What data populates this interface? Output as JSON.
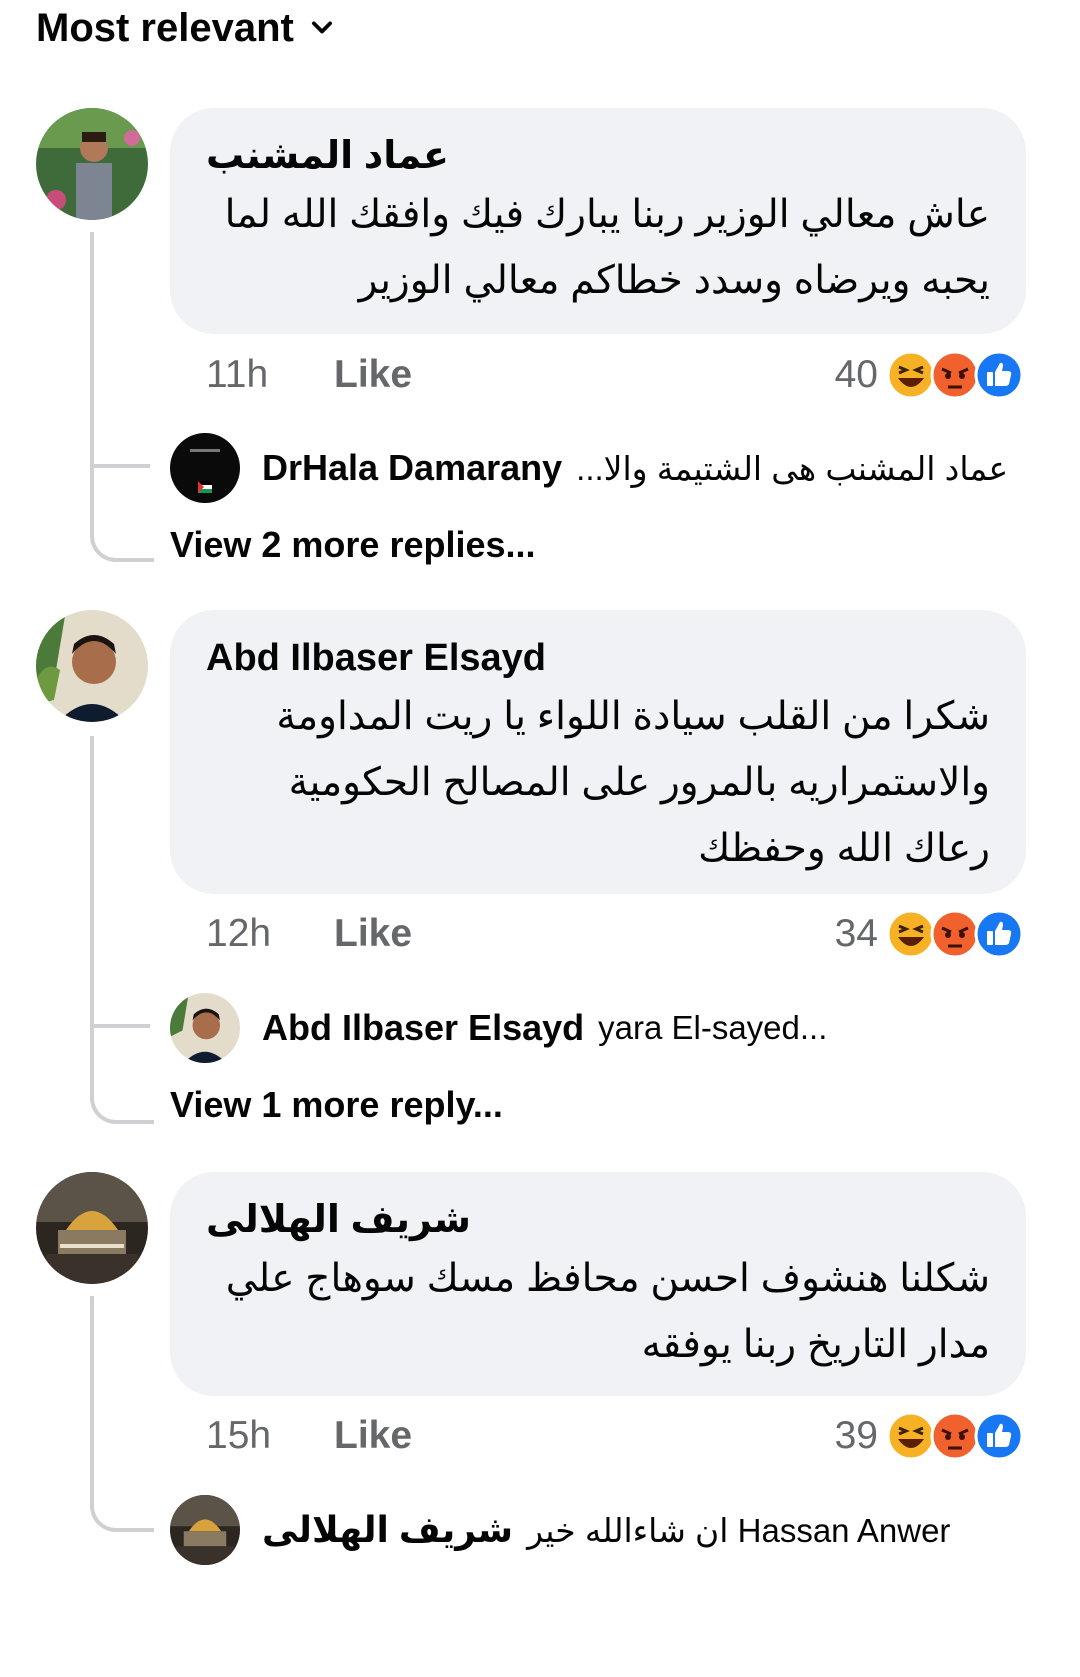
{
  "sort": {
    "label": "Most relevant"
  },
  "comments": [
    {
      "author": "عماد المشنب",
      "text": "عاش معالي الوزير ربنا يبارك فيك وافقك الله لما يحبه ويرضاه وسدد خطاكم معالي الوزير",
      "time": "11h",
      "like_label": "Like",
      "reaction_count": "40",
      "reply": {
        "author": "DrHala Damarany",
        "preview": "عماد المشنب هى الشتيمة والا..."
      },
      "more_replies": "View 2 more replies..."
    },
    {
      "author": "Abd Ilbaser Elsayd",
      "text": "شكرا من القلب سيادة اللواء يا ريت المداومة والاستمراريه بالمرور على المصالح الحكومية رعاك الله وحفظك",
      "time": "12h",
      "like_label": "Like",
      "reaction_count": "34",
      "reply": {
        "author": "Abd Ilbaser Elsayd",
        "preview": "yara El-sayed..."
      },
      "more_replies": "View 1 more reply..."
    },
    {
      "author": "شريف الهلالى",
      "text": "شكلنا هنشوف احسن محافظ مسك سوهاج علي مدار التاريخ ربنا يوفقه",
      "time": "15h",
      "like_label": "Like",
      "reaction_count": "39",
      "reply": {
        "author": "شريف الهلالى",
        "preview": "Hassan Anwer ان شاءالله خير"
      }
    }
  ],
  "reaction_icons": [
    "haha-icon",
    "angry-icon",
    "like-icon"
  ],
  "colors": {
    "bubble": "#f0f2f5",
    "meta": "#65676b",
    "like_blue": "#1877f2",
    "angry": "#f0612d",
    "haha": "#f7b125"
  }
}
